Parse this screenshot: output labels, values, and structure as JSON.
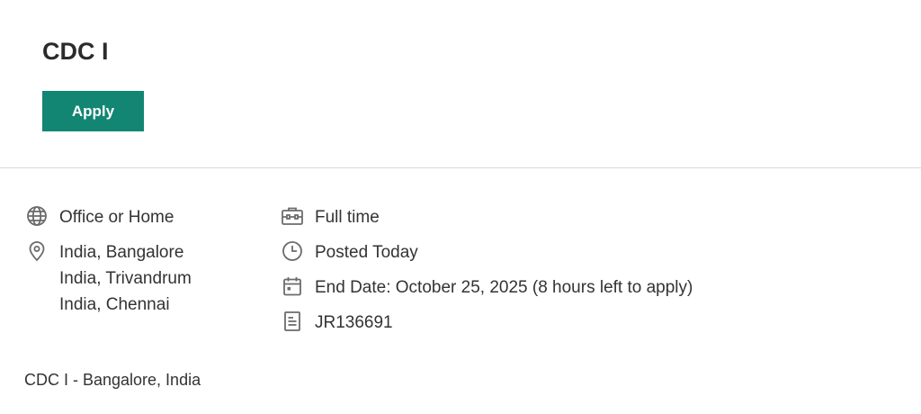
{
  "job": {
    "title": "CDC I",
    "apply_label": "Apply",
    "work_mode": "Office or Home",
    "locations": [
      "India, Bangalore",
      "India, Trivandrum",
      "India, Chennai"
    ],
    "time_type": "Full time",
    "posted": "Posted Today",
    "end_date": "End Date: October 25, 2025 (8 hours left to apply)",
    "requisition_id": "JR136691",
    "description_start": "CDC I - Bangalore, India"
  },
  "icons": {
    "work_mode": "globe-icon",
    "locations": "location-pin-icon",
    "time_type": "briefcase-icon",
    "posted": "clock-icon",
    "end_date": "calendar-icon",
    "requisition_id": "document-icon"
  },
  "colors": {
    "accent": "#128672",
    "icon": "#6b6b6b",
    "text": "#333333",
    "divider": "#d9d9d9"
  }
}
